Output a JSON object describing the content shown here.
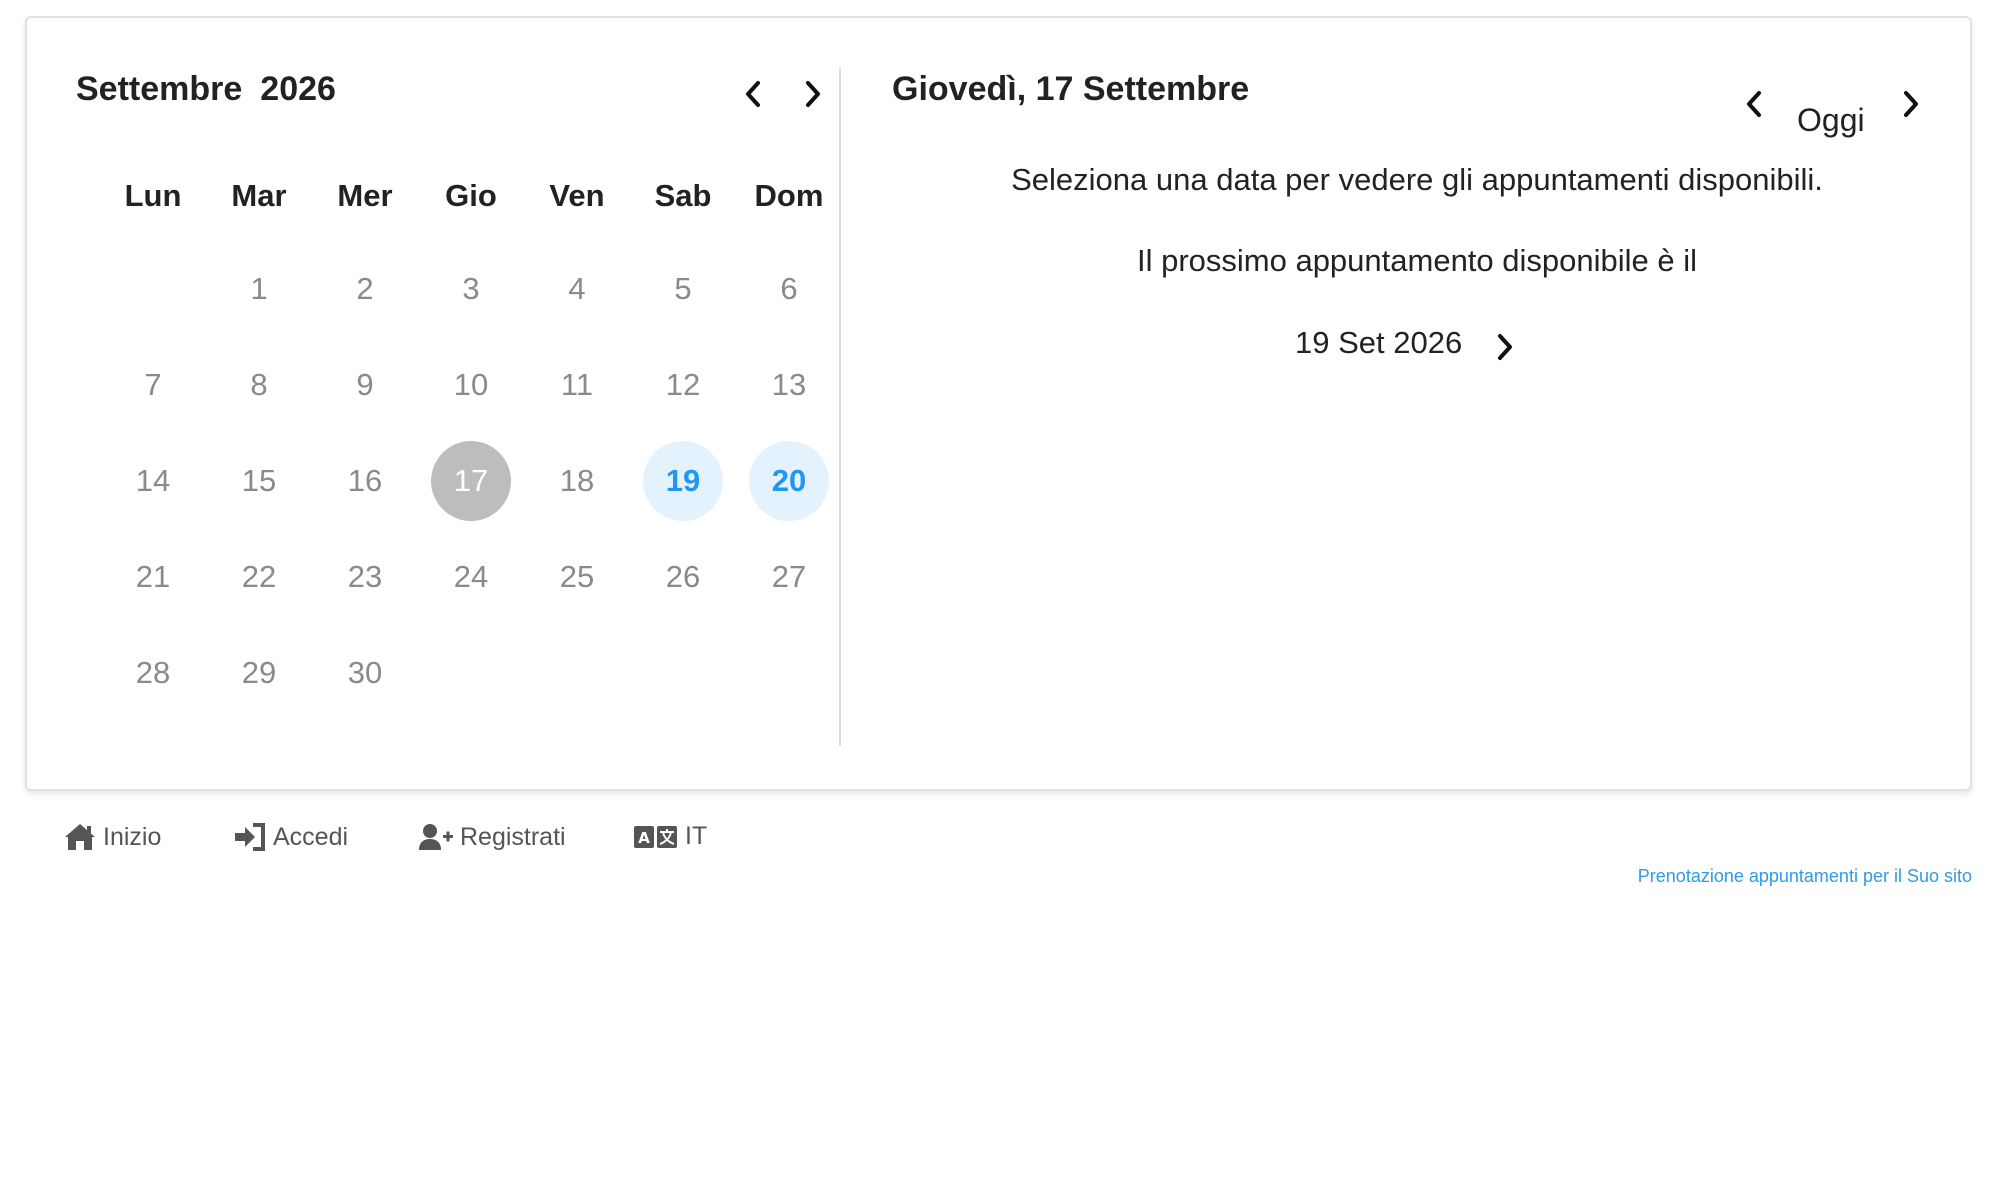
{
  "calendar": {
    "month": "Settembre",
    "year": "2026",
    "weekdays": [
      "Lun",
      "Mar",
      "Mer",
      "Gio",
      "Ven",
      "Sab",
      "Dom"
    ],
    "leading_blanks": 1,
    "days": [
      "1",
      "2",
      "3",
      "4",
      "5",
      "6",
      "7",
      "8",
      "9",
      "10",
      "11",
      "12",
      "13",
      "14",
      "15",
      "16",
      "17",
      "18",
      "19",
      "20",
      "21",
      "22",
      "23",
      "24",
      "25",
      "26",
      "27",
      "28",
      "29",
      "30"
    ],
    "selected_day": "17",
    "available_days": [
      "19",
      "20"
    ],
    "prev_icon": "chevron-left-icon",
    "next_icon": "chevron-right-icon"
  },
  "details": {
    "date_title": "Giovedì, 17 Settembre",
    "today_label": "Oggi",
    "select_message": "Seleziona una data per vedere gli appuntamenti disponibili.",
    "next_message": "Il prossimo appuntamento disponibile è il",
    "next_date": "19 Set 2026"
  },
  "footer": {
    "links": [
      {
        "label": "Inizio",
        "icon": "home-icon"
      },
      {
        "label": "Accedi",
        "icon": "sign-in-icon"
      },
      {
        "label": "Registrati",
        "icon": "user-plus-icon"
      },
      {
        "label": "IT",
        "icon": "language-icon"
      }
    ],
    "note": "Prenotazione appuntamenti per il Suo sito"
  },
  "colors": {
    "accent": "#2196f3",
    "available_bg": "#e3f2fd",
    "selected_bg": "#bdbdbd",
    "day_text": "#8a8a8a",
    "note_link": "#2f9be6"
  }
}
